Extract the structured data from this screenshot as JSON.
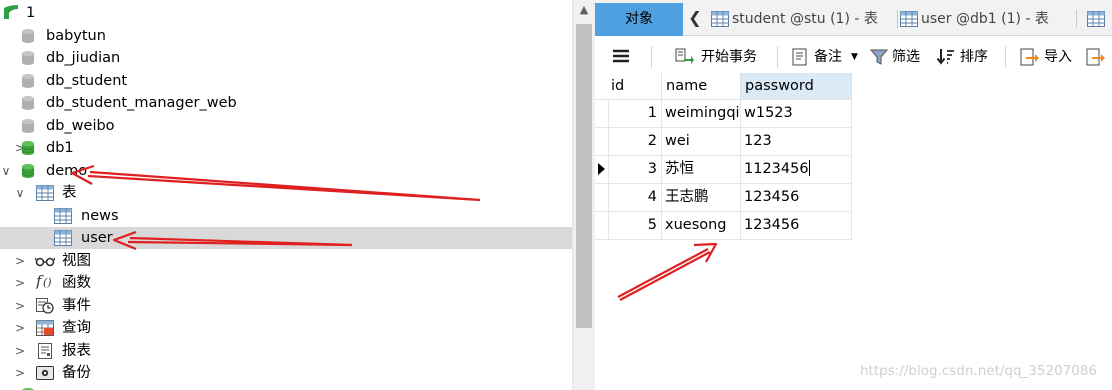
{
  "tree": {
    "root_label": "1",
    "databases": [
      "babytun",
      "db_jiudian",
      "db_student",
      "db_student_manager_web",
      "db_weibo"
    ],
    "db1": "db1",
    "demo": "demo",
    "tables_group": "表",
    "tables": [
      "news",
      "user"
    ],
    "groups": [
      "视图",
      "函数",
      "事件",
      "查询",
      "报表",
      "备份"
    ]
  },
  "tabs": {
    "objects": "对象",
    "tab1": "student @stu (1) - 表",
    "tab2": "user @db1 (1) - 表"
  },
  "toolbar": {
    "begin_transaction": "开始事务",
    "memo": "备注",
    "filter": "筛选",
    "sort": "排序",
    "import": "导入"
  },
  "grid": {
    "columns": [
      "id",
      "name",
      "password"
    ],
    "rows": [
      {
        "id": "1",
        "name": "weimingqi",
        "password": "w1523"
      },
      {
        "id": "2",
        "name": "wei",
        "password": "123"
      },
      {
        "id": "3",
        "name": "苏恒",
        "password": "1123456"
      },
      {
        "id": "4",
        "name": "王志鹏",
        "password": "123456"
      },
      {
        "id": "5",
        "name": "xuesong",
        "password": "123456"
      }
    ]
  },
  "watermark": "https://blog.csdn.net/qq_35207086",
  "colors": {
    "active_tab": "#4ea0e0",
    "selected_row": "#d9d9d9",
    "db_green": "#3aa53a",
    "db_gray": "#b8b8b8",
    "arrow_red": "#e02020",
    "header_highlight": "#dbeaf7"
  }
}
